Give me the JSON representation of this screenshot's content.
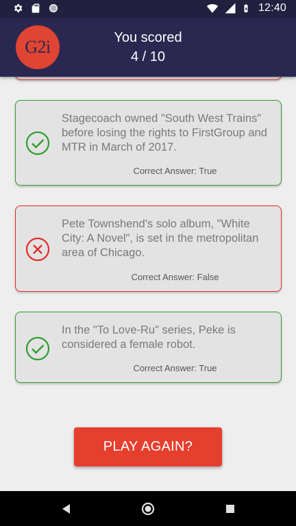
{
  "status_bar": {
    "time": "12:40",
    "left_icons": [
      "gear-icon",
      "sd-card-icon",
      "circle-icon"
    ],
    "right_icons": [
      "wifi-icon",
      "signal-icon",
      "battery-charging-icon"
    ]
  },
  "header": {
    "logo_text": "G2i",
    "title": "You scored",
    "score": "4 / 10"
  },
  "colors": {
    "header_bg": "#2a2850",
    "status_bg": "#21203f",
    "correct": "#2e9e2e",
    "wrong": "#e52a2a",
    "button": "#e53f2e"
  },
  "results": [
    {
      "question": "Stagecoach owned \"South West Trains\" before losing the rights to FirstGroup and MTR in March of 2017.",
      "answer_label": "Correct Answer: True",
      "status": "correct",
      "icon": "check-circle-icon"
    },
    {
      "question": "Pete Townshend's solo album, \"White City: A Novel\", is set in the metropolitan area of Chicago.",
      "answer_label": "Correct Answer: False",
      "status": "wrong",
      "icon": "x-circle-icon"
    },
    {
      "question": "In the \"To Love-Ru\" series, Peke is considered a female robot.",
      "answer_label": "Correct Answer: True",
      "status": "correct",
      "icon": "check-circle-icon"
    }
  ],
  "play_again_label": "PLAY AGAIN?",
  "nav_bar": {
    "icons": [
      "back-icon",
      "home-icon",
      "recents-icon"
    ]
  }
}
